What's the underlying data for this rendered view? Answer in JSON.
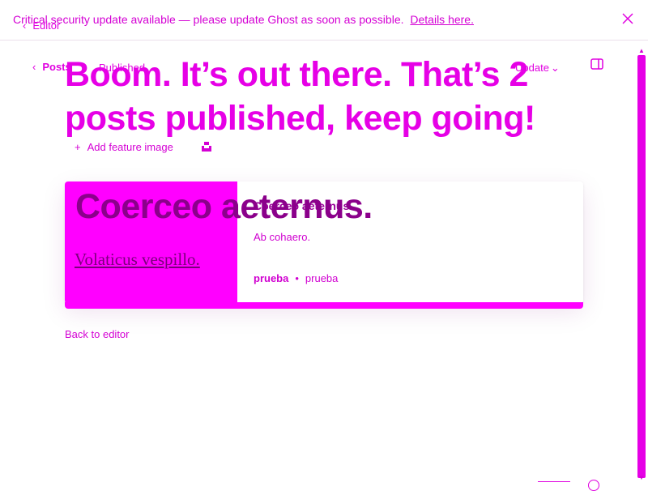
{
  "banner": {
    "text": "Critical security update available — please update Ghost as soon as possible.",
    "link_label": "Details here.",
    "close_icon": "close-icon"
  },
  "nav": {
    "editor_back_label": "Editor"
  },
  "header": {
    "posts_label": "Posts",
    "status_label": "Published",
    "update_label": "Update",
    "sidebar_icon": "sidebar-toggle-icon"
  },
  "publish": {
    "headline": "Boom. It’s out there. That’s 2 posts published, keep going!"
  },
  "feature_image": {
    "add_label": "Add feature image",
    "unsplash_icon": "unsplash-icon"
  },
  "card": {
    "overlay_title": "Coerceo aeternus.",
    "image_text": "Volaticus vespillo.",
    "title": "Coerceo aeternus.",
    "excerpt": "Ab cohaero.",
    "author": "prueba",
    "separator": "•",
    "tag": "prueba"
  },
  "footer": {
    "back_to_editor_label": "Back to editor"
  },
  "colors": {
    "accent": "#e600e6",
    "image_bg": "#ff00ff",
    "title_dark": "#8b008b"
  }
}
